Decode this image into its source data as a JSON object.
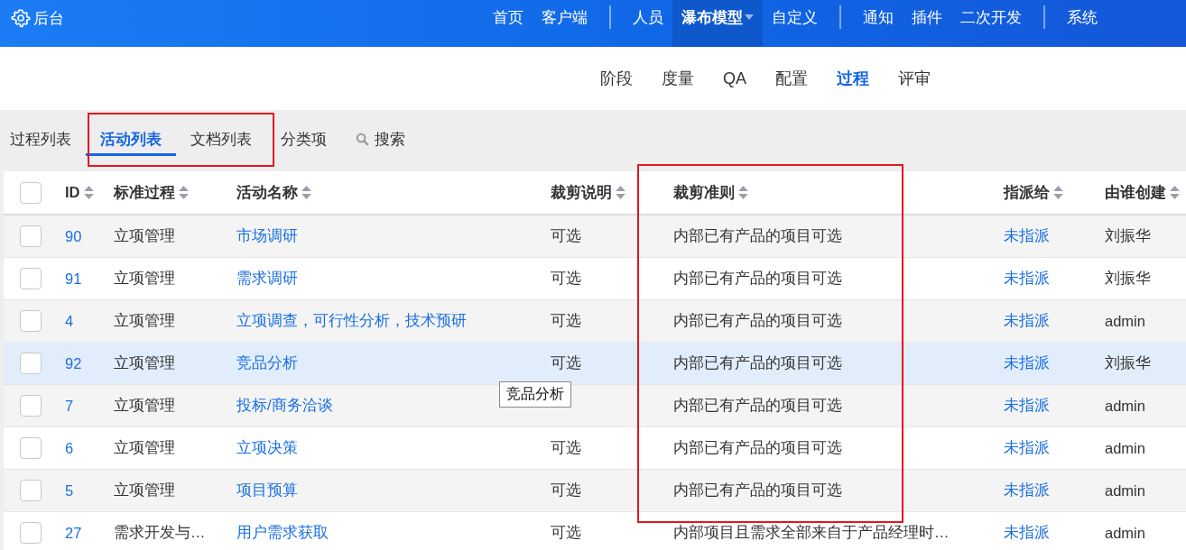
{
  "header": {
    "brand": "后台",
    "nav_groups": [
      [
        {
          "label": "首页",
          "selected": false,
          "dropdown": false
        },
        {
          "label": "客户端",
          "selected": false,
          "dropdown": false
        }
      ],
      [
        {
          "label": "人员",
          "selected": false,
          "dropdown": false
        },
        {
          "label": "瀑布模型",
          "selected": true,
          "dropdown": true
        },
        {
          "label": "自定义",
          "selected": false,
          "dropdown": false
        }
      ],
      [
        {
          "label": "通知",
          "selected": false,
          "dropdown": false
        },
        {
          "label": "插件",
          "selected": false,
          "dropdown": false
        },
        {
          "label": "二次开发",
          "selected": false,
          "dropdown": false
        }
      ],
      [
        {
          "label": "系统",
          "selected": false,
          "dropdown": false
        }
      ]
    ]
  },
  "sub_nav": [
    {
      "label": "阶段",
      "selected": false
    },
    {
      "label": "度量",
      "selected": false
    },
    {
      "label": "QA",
      "selected": false
    },
    {
      "label": "配置",
      "selected": false
    },
    {
      "label": "过程",
      "selected": true
    },
    {
      "label": "评审",
      "selected": false
    }
  ],
  "toolbar": [
    {
      "kind": "tab",
      "label": "过程列表",
      "selected": false
    },
    {
      "kind": "tab",
      "label": "活动列表",
      "selected": true
    },
    {
      "kind": "tab",
      "label": "文档列表",
      "selected": false
    },
    {
      "kind": "tab",
      "label": "分类项",
      "selected": false
    },
    {
      "kind": "search",
      "label": "搜索",
      "selected": false
    }
  ],
  "table": {
    "all_checked": false,
    "columns": [
      "ID",
      "标准过程",
      "活动名称",
      "裁剪说明",
      "裁剪准则",
      "指派给",
      "由谁创建"
    ],
    "rows": [
      {
        "checked": false,
        "highlighted": false,
        "id": "90",
        "process": "立项管理",
        "name": "市场调研",
        "tailoring_note": "可选",
        "tailoring_rule": "内部已有产品的项目可选",
        "assigned_to": "未指派",
        "created_by": "刘振华"
      },
      {
        "checked": false,
        "highlighted": false,
        "id": "91",
        "process": "立项管理",
        "name": "需求调研",
        "tailoring_note": "可选",
        "tailoring_rule": "内部已有产品的项目可选",
        "assigned_to": "未指派",
        "created_by": "刘振华"
      },
      {
        "checked": false,
        "highlighted": false,
        "id": "4",
        "process": "立项管理",
        "name": "立项调查，可行性分析，技术预研",
        "tailoring_note": "可选",
        "tailoring_rule": "内部已有产品的项目可选",
        "assigned_to": "未指派",
        "created_by": "admin"
      },
      {
        "checked": false,
        "highlighted": true,
        "id": "92",
        "process": "立项管理",
        "name": "竞品分析",
        "tailoring_note": "可选",
        "tailoring_rule": "内部已有产品的项目可选",
        "assigned_to": "未指派",
        "created_by": "刘振华"
      },
      {
        "checked": false,
        "highlighted": false,
        "id": "7",
        "process": "立项管理",
        "name": "投标/商务洽谈",
        "tailoring_rule": "内部已有产品的项目可选",
        "assigned_to": "未指派",
        "created_by": "admin"
      },
      {
        "checked": false,
        "highlighted": false,
        "id": "6",
        "process": "立项管理",
        "name": "立项决策",
        "tailoring_note": "可选",
        "tailoring_rule": "内部已有产品的项目可选",
        "assigned_to": "未指派",
        "created_by": "admin"
      },
      {
        "checked": false,
        "highlighted": false,
        "id": "5",
        "process": "立项管理",
        "name": "项目预算",
        "tailoring_note": "可选",
        "tailoring_rule": "内部已有产品的项目可选",
        "assigned_to": "未指派",
        "created_by": "admin"
      },
      {
        "checked": false,
        "highlighted": false,
        "id": "27",
        "process": "需求开发与…",
        "name": "用户需求获取",
        "tailoring_note": "可选",
        "tailoring_rule": "内部项目且需求全部来自于产品经理时…",
        "assigned_to": "未指派",
        "created_by": "admin"
      }
    ]
  },
  "tooltip": {
    "text": "竞品分析"
  }
}
